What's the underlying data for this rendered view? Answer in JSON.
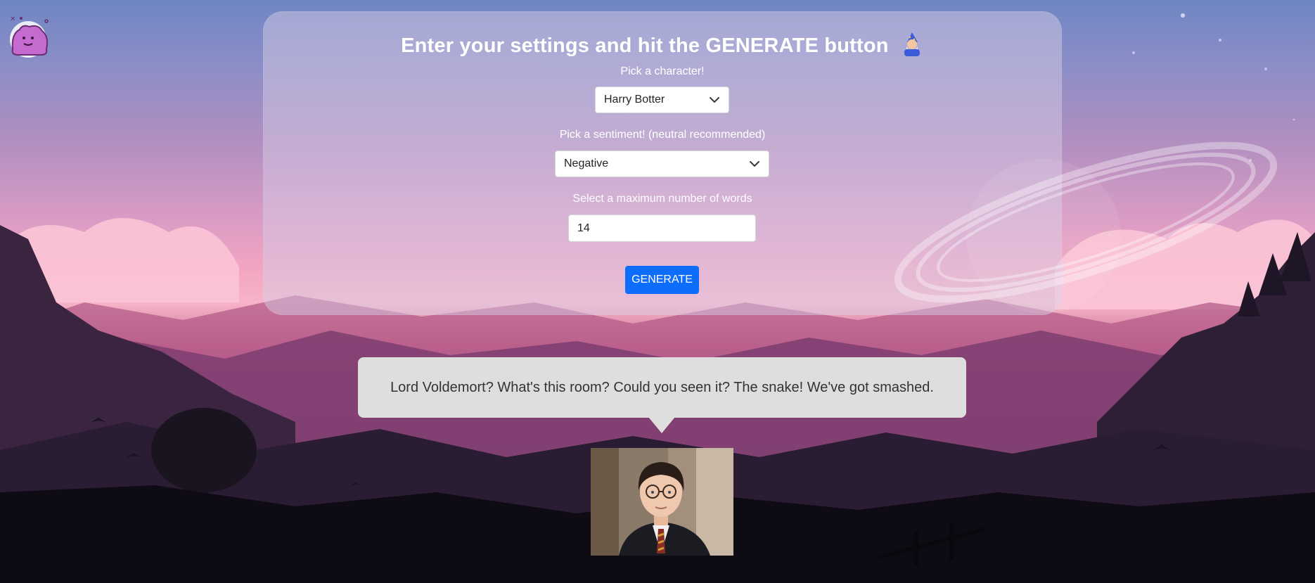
{
  "form": {
    "title": "Enter your settings and hit the GENERATE button",
    "character_label": "Pick a character!",
    "character_value": "Harry Botter",
    "sentiment_label": "Pick a sentiment! (neutral recommended)",
    "sentiment_value": "Negative",
    "words_label": "Select a maximum number of words",
    "words_value": "14",
    "generate_label": "GENERATE"
  },
  "output": {
    "text": "Lord Voldemort? What's this room? Could you seen it? The snake! We've got smashed."
  },
  "icons": {
    "logo": "ditto-mascot-icon",
    "title_emoji": "wizard-emoji-icon",
    "select_arrow": "chevron-down-icon"
  },
  "colors": {
    "primary_button": "#0d6efd",
    "panel_overlay": "#d7cde6",
    "bubble_bg": "#dedede"
  }
}
